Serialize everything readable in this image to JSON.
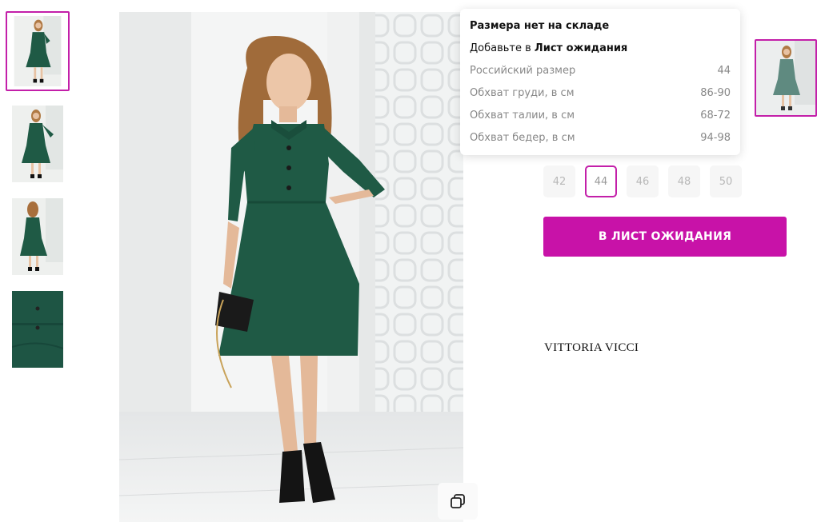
{
  "gallery": {
    "thumbnails": [
      {
        "alt": "front-view"
      },
      {
        "alt": "side-view"
      },
      {
        "alt": "back-view"
      },
      {
        "alt": "fabric-detail"
      }
    ]
  },
  "tooltip": {
    "title": "Размера нет на складе",
    "add_prefix": "Добавьте в ",
    "add_link": "Лист ожидания",
    "rows": [
      {
        "label": "Российский размер",
        "value": "44"
      },
      {
        "label": "Обхват груди, в см",
        "value": "86-90"
      },
      {
        "label": "Обхват талии, в см",
        "value": "68-72"
      },
      {
        "label": "Обхват бедер, в см",
        "value": "94-98"
      }
    ]
  },
  "sizes": [
    "42",
    "44",
    "46",
    "48",
    "50"
  ],
  "selected_size": "44",
  "cta_label": "В ЛИСТ ОЖИДАНИЯ",
  "brand": "VITTORIA VICCI",
  "colors": {
    "accent": "#c812a8",
    "dress": "#1f5a45"
  }
}
